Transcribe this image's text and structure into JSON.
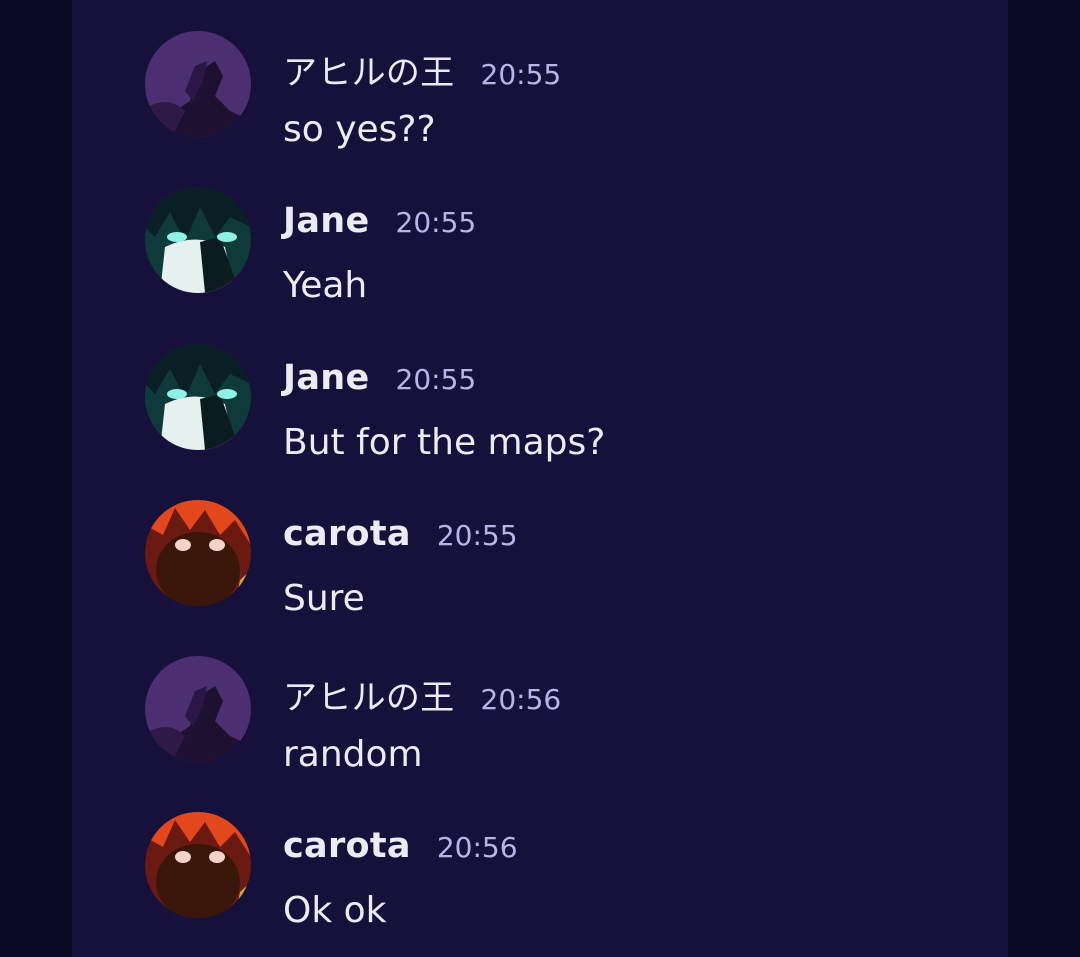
{
  "messages": [
    {
      "author": "アヒルの王",
      "time": "20:55",
      "text": "so yes??",
      "avatar": "purple-sketch-avatar"
    },
    {
      "author": "Jane",
      "time": "20:55",
      "text": "Yeah",
      "avatar": "teal-anime-avatar"
    },
    {
      "author": "Jane",
      "time": "20:55",
      "text": "But for the maps?",
      "avatar": "teal-anime-avatar"
    },
    {
      "author": "carota",
      "time": "20:55",
      "text": "Sure",
      "avatar": "red-anime-avatar"
    },
    {
      "author": "アヒルの王",
      "time": "20:56",
      "text": "random",
      "avatar": "purple-sketch-avatar"
    },
    {
      "author": "carota",
      "time": "20:56",
      "text": "Ok ok",
      "avatar": "red-anime-avatar"
    }
  ],
  "colors": {
    "outer_background": "#0b0a26",
    "panel_background": "#16113b",
    "author_text": "#eceaf2",
    "timestamp_text": "#b9b4e6",
    "message_text": "#eceaf2"
  }
}
